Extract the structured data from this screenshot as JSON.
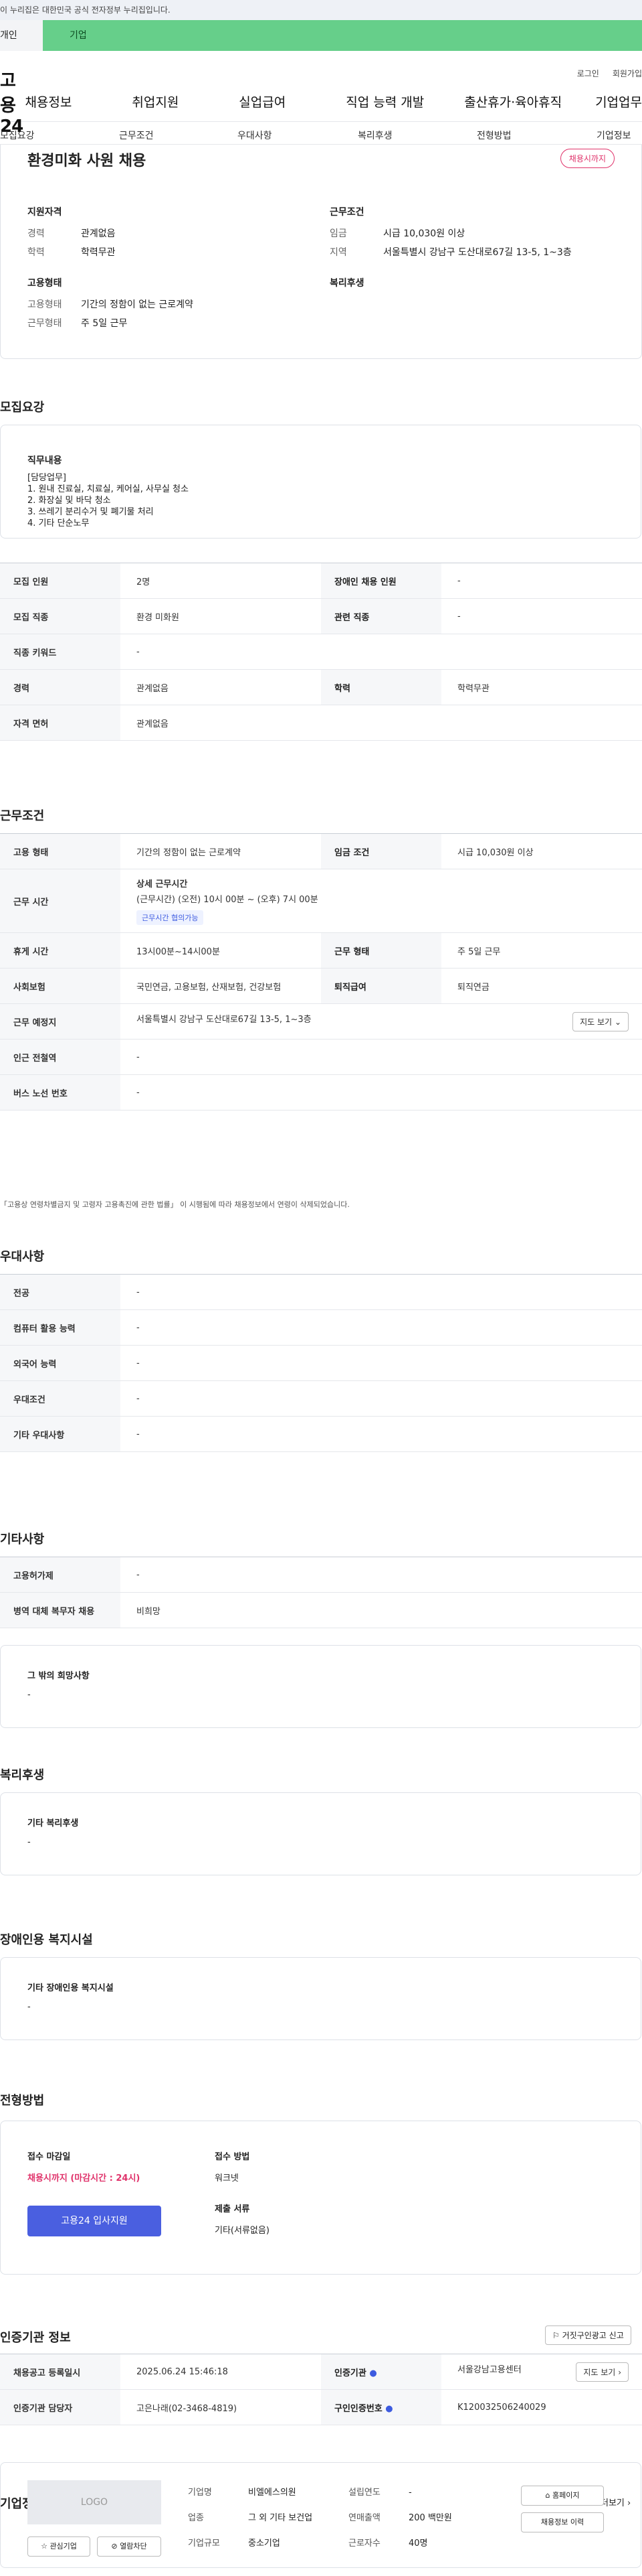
{
  "gov_notice": "이 누리집은 대한민국 공식 전자정부 누리집입니다.",
  "user_tabs": {
    "personal": "개인",
    "company": "기업"
  },
  "util": {
    "login": "로그인",
    "signup": "회원가입"
  },
  "gnb": {
    "logo": "고용24",
    "items": [
      "채용정보",
      "취업지원",
      "실업급여",
      "직업 능력 개발",
      "출산휴가·육아휴직",
      "기업업무"
    ]
  },
  "subnav": [
    "모집요강",
    "근무조건",
    "우대사항",
    "복리후생",
    "전형방법",
    "기업정보"
  ],
  "job": {
    "title": "환경미화 사원 채용",
    "status_badge": "채용시까지"
  },
  "summary": {
    "qual_title": "지원자격",
    "cond_title": "근무조건",
    "emp_title": "고용형태",
    "welfare_title": "복리후생",
    "qual": [
      {
        "k": "경력",
        "v": "관계없음"
      },
      {
        "k": "학력",
        "v": "학력무관"
      }
    ],
    "cond": [
      {
        "k": "임금",
        "v": "시급 10,030원 이상"
      },
      {
        "k": "지역",
        "v": "서울특별시 강남구 도산대로67길 13-5, 1~3층"
      }
    ],
    "emp": [
      {
        "k": "고용형태",
        "v": "기간의 정함이 없는 근로계약"
      },
      {
        "k": "근무형태",
        "v": "주 5일 근무"
      }
    ]
  },
  "recruit": {
    "title": "모집요강",
    "duty_title": "직무내용",
    "duty_lines": [
      "[담당업무]",
      "1. 원내 진료실, 치료실, 케어실, 사무실 청소",
      "2. 화장실 및 바닥 청소",
      "3. 쓰레기 분리수거 및 폐기물 처리",
      "4. 기타 단순노무"
    ],
    "rows": [
      {
        "k1": "모집 인원",
        "v1": "2명",
        "k2": "장애인 채용 인원",
        "v2": "-"
      },
      {
        "k1": "모집 직종",
        "v1": "환경 미화원",
        "k2": "관련 직종",
        "v2": "-"
      },
      {
        "k1": "직종 키워드",
        "v1": "-"
      },
      {
        "k1": "경력",
        "v1": "관계없음",
        "k2": "학력",
        "v2": "학력무관"
      },
      {
        "k1": "자격 면허",
        "v1": "관계없음"
      }
    ]
  },
  "work": {
    "title": "근무조건",
    "type_k": "고용 형태",
    "type_v": "기간의 정함이 없는 근로계약",
    "wage_k": "임금 조건",
    "wage_v": "시급 10,030원 이상",
    "time_k": "근무 시간",
    "time_title": "상세 근무시간",
    "time_v": "(근무시간) (오전) 10시 00분 ~ (오후) 7시 00분",
    "time_chip": "근무시간 협의가능",
    "break_k": "휴게 시간",
    "break_v": "13시00분~14시00분",
    "form_k": "근무 형태",
    "form_v": "주 5일 근무",
    "ins_k": "사회보험",
    "ins_v": "국민연금, 고용보험, 산재보험, 건강보험",
    "ret_k": "퇴직급여",
    "ret_v": "퇴직연금",
    "loc_k": "근무 예정지",
    "loc_v": "서울특별시 강남구 도산대로67길 13-5, 1~3층",
    "map_btn": "지도 보기",
    "sub_k": "인근 전철역",
    "sub_v": "-",
    "bus_k": "버스 노선 번호",
    "bus_v": "-",
    "note": "「고용상 연령차별금지 및 고령자 고용촉진에 관한 법률」 이 시행됨에 따라 채용정보에서 연령이 삭제되었습니다."
  },
  "pref": {
    "title": "우대사항",
    "rows": [
      {
        "k": "전공",
        "v": "-"
      },
      {
        "k": "컴퓨터 활용 능력",
        "v": "-"
      },
      {
        "k": "외국어 능력",
        "v": "-"
      },
      {
        "k": "우대조건",
        "v": "-"
      },
      {
        "k": "기타 우대사항",
        "v": "-"
      }
    ]
  },
  "etc": {
    "title": "기타사항",
    "rows": [
      {
        "k": "고용허가제",
        "v": "-"
      },
      {
        "k": "병역 대체 복무자 채용",
        "v": "비희망"
      }
    ],
    "hope_title": "그 밖의 희망사항",
    "hope_v": "-"
  },
  "welfare": {
    "title": "복리후생",
    "sub": "기타 복리후생",
    "v": "-"
  },
  "disability": {
    "title": "장애인용 복지시설",
    "sub": "기타 장애인용 복지시설",
    "v": "-"
  },
  "process": {
    "title": "전형방법",
    "deadline_k": "접수 마감일",
    "deadline_v": "채용시까지 (마감시간 : 24시)",
    "method_k": "접수 방법",
    "method_v": "워크넷",
    "apply_btn": "고용24 입사지원",
    "docs_k": "제출 서류",
    "docs_v": "기타(서류없음)"
  },
  "cert": {
    "title": "인증기관 정보",
    "report_btn": "거짓구인광고 신고",
    "reg_k": "채용공고 등록일시",
    "reg_v": "2025.06.24 15:46:18",
    "org_k": "인증기관",
    "org_v": "서울강남고용센터",
    "map_btn": "지도 보기",
    "mgr_k": "인증기관 담당자",
    "mgr_v": "고은나래(02-3468-4819)",
    "num_k": "구인인증번호",
    "num_v": "K120032506240029"
  },
  "company": {
    "title": "기업정보",
    "more": "더보기",
    "logo": "LOGO",
    "fav_btn": "관심기업",
    "block_btn": "열람차단",
    "name_k": "기업명",
    "name_v": "비엘에스의원",
    "est_k": "설립연도",
    "est_v": "-",
    "ind_k": "업종",
    "ind_v": "그 외 기타 보건업",
    "sales_k": "연매출액",
    "sales_v": "200 백만원",
    "size_k": "기업규모",
    "size_v": "중소기업",
    "emp_k": "근로자수",
    "emp_v": "40명",
    "home_btn": "홈페이지",
    "jobs_btn": "채용정보 이력"
  }
}
